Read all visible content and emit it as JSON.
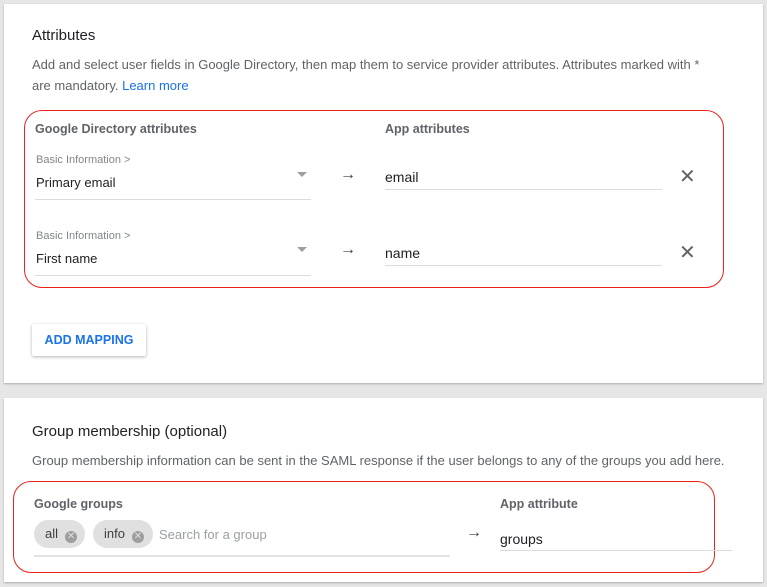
{
  "attributes": {
    "title": "Attributes",
    "description": "Add and select user fields in Google Directory, then map them to service provider attributes. Attributes marked with * are mandatory.",
    "learn_more": "Learn more",
    "col_directory": "Google Directory attributes",
    "col_app": "App attributes",
    "mappings": [
      {
        "category": "Basic Information >",
        "field": "Primary email",
        "app_attr": "email"
      },
      {
        "category": "Basic Information >",
        "field": "First name",
        "app_attr": "name"
      }
    ],
    "add_mapping": "ADD MAPPING"
  },
  "group": {
    "title": "Group membership (optional)",
    "description": "Group membership information can be sent in the SAML response if the user belongs to any of the groups you add here.",
    "col_groups": "Google groups",
    "col_app": "App attribute",
    "chips": [
      "all",
      "info"
    ],
    "search_placeholder": "Search for a group",
    "app_attr": "groups"
  },
  "icons": {
    "arrow": "→",
    "remove": "✕",
    "chip_remove": "✕"
  },
  "colors": {
    "highlight": "#e8231a",
    "accent": "#1a73e8"
  }
}
